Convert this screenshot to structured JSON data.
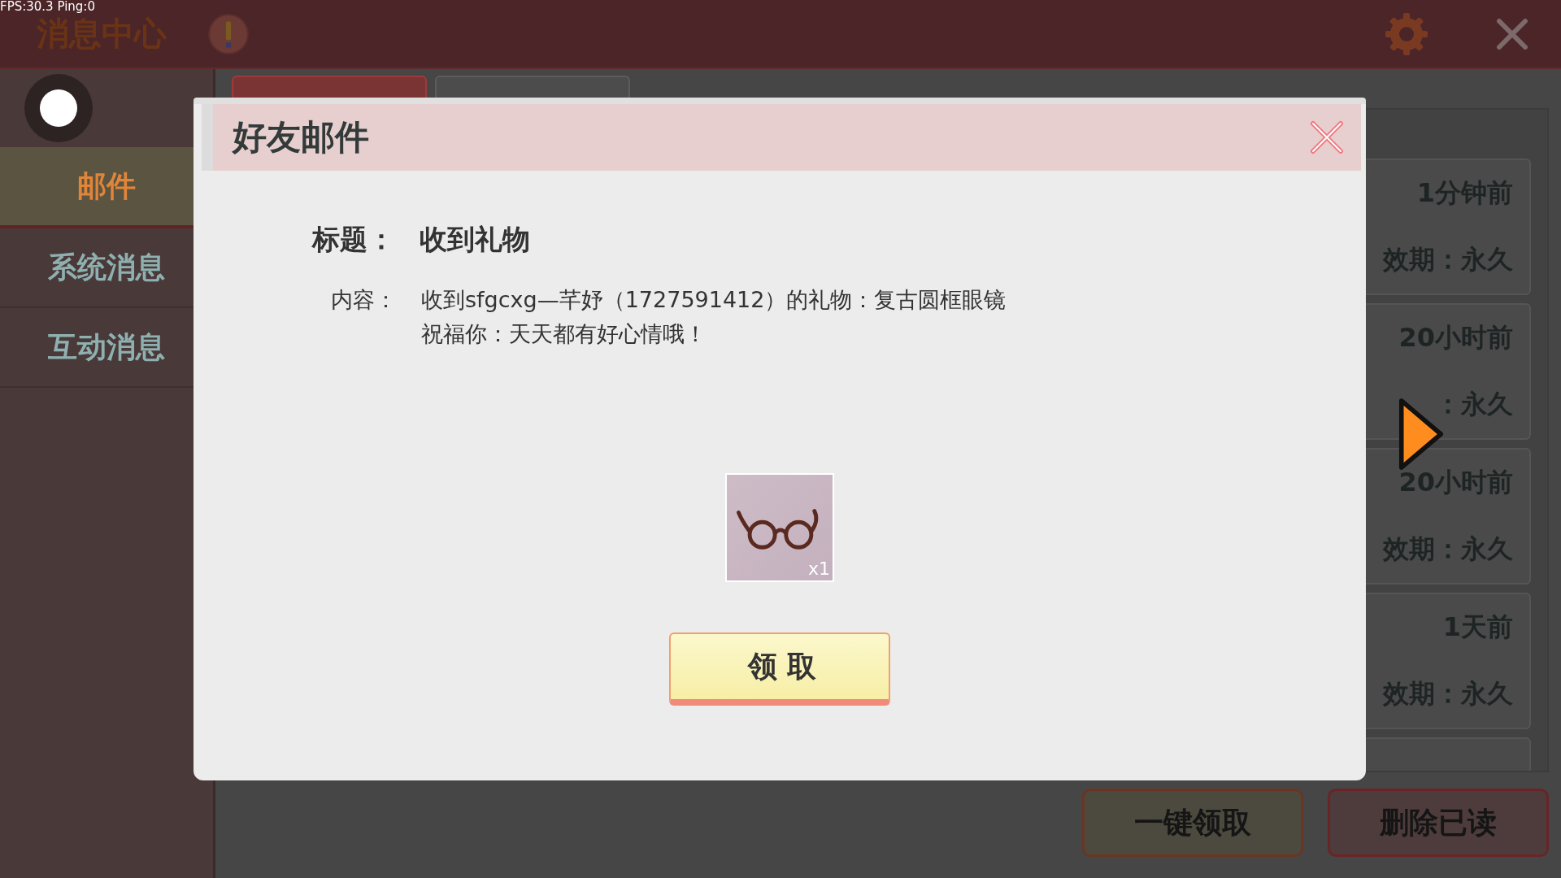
{
  "status_overlay": "FPS:30.3  Ping:0",
  "header": {
    "title": "消息中心"
  },
  "sidebar": {
    "items": [
      {
        "label": "邮件",
        "selected": true
      },
      {
        "label": "系统消息",
        "selected": false
      },
      {
        "label": "互动消息",
        "selected": false
      }
    ]
  },
  "tabs": [
    {
      "selected": true
    },
    {
      "selected": false
    }
  ],
  "mail_list": [
    {
      "time": "1分钟前",
      "validity": "效期：永久"
    },
    {
      "time": "20小时前",
      "validity": "：永久"
    },
    {
      "time": "20小时前",
      "validity": "效期：永久"
    },
    {
      "time": "1天前",
      "validity": "效期：永久"
    }
  ],
  "actions": [
    {
      "label": "一键领取",
      "kind": "claim"
    },
    {
      "label": "删除已读",
      "kind": "delete"
    }
  ],
  "dialog": {
    "title": "好友邮件",
    "subject_label": "标题：",
    "subject": "收到礼物",
    "content_label": "内容：",
    "content_lines": [
      "收到sfgcxg—芊妤（1727591412）的礼物：复古圆框眼镜",
      "祝福你：天天都有好心情哦！"
    ],
    "item": {
      "count": "x1"
    },
    "claim_button": "领取"
  }
}
